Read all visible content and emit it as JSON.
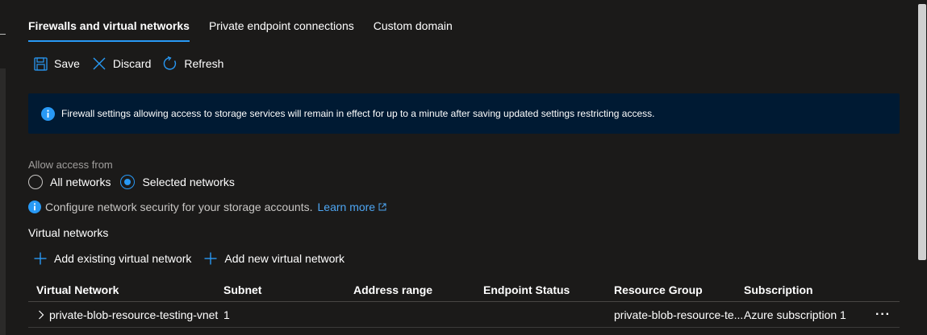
{
  "tabs": [
    {
      "label": "Firewalls and virtual networks"
    },
    {
      "label": "Private endpoint connections"
    },
    {
      "label": "Custom domain"
    }
  ],
  "toolbar": {
    "save_label": "Save",
    "discard_label": "Discard",
    "refresh_label": "Refresh"
  },
  "banner": {
    "text": "Firewall settings allowing access to storage services will remain in effect for up to a minute after saving updated settings restricting access.",
    "background": "#001a33"
  },
  "access": {
    "label": "Allow access from",
    "options": [
      {
        "label": "All networks",
        "checked": false
      },
      {
        "label": "Selected networks",
        "checked": true
      }
    ]
  },
  "config": {
    "text": "Configure network security for your storage accounts.",
    "link_label": "Learn more"
  },
  "virtual_networks": {
    "title": "Virtual networks",
    "add_existing_label": "Add existing virtual network",
    "add_new_label": "Add new virtual network",
    "columns": [
      "Virtual Network",
      "Subnet",
      "Address range",
      "Endpoint Status",
      "Resource Group",
      "Subscription"
    ],
    "rows": [
      {
        "virtual_network": "private-blob-resource-testing-vnet",
        "subnet": "1",
        "address_range": "",
        "endpoint_status": "",
        "resource_group": "private-blob-resource-te...",
        "subscription": "Azure subscription 1",
        "more": "···"
      }
    ]
  },
  "colors": {
    "accent": "#2899f5",
    "link": "#4ea6f3",
    "background": "#1b1a19"
  },
  "icons": {
    "save": "save-icon",
    "discard": "close-icon",
    "refresh": "refresh-icon",
    "info": "info-icon",
    "external": "external-link-icon",
    "add": "plus-icon",
    "expand": "chevron-right-icon",
    "more": "more-icon"
  }
}
